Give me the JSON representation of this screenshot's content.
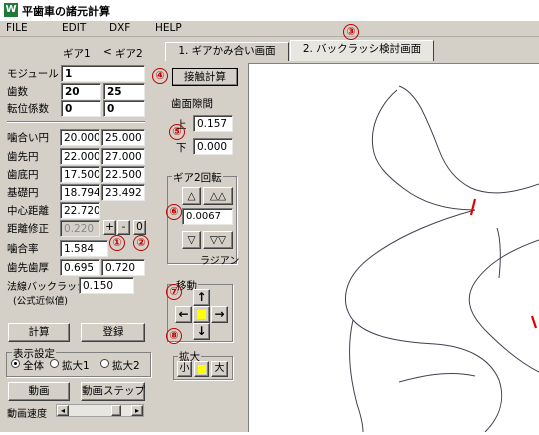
{
  "window": {
    "title": "平歯車の諸元計算"
  },
  "menu": [
    "FILE",
    "EDIT",
    "DXF",
    "HELP"
  ],
  "tabs": [
    "1. ギアかみ合い画面",
    "2. バックラッシ検討画面"
  ],
  "gear_header": {
    "gear1": "ギア1",
    "lt": "<",
    "gear2": "ギア2"
  },
  "params": {
    "module": {
      "label": "モジュール",
      "g1": "1"
    },
    "teeth": {
      "label": "歯数",
      "g1": "20",
      "g2": "25"
    },
    "shift": {
      "label": "転位係数",
      "g1": "0",
      "g2": "0"
    }
  },
  "results": {
    "pitch": {
      "label": "噛合い円",
      "g1": "20.000",
      "g2": "25.000"
    },
    "tip": {
      "label": "歯先円",
      "g1": "22.000",
      "g2": "27.000"
    },
    "root": {
      "label": "歯底円",
      "g1": "17.500",
      "g2": "22.500"
    },
    "base": {
      "label": "基礎円",
      "g1": "18.794",
      "g2": "23.492"
    },
    "center": {
      "label": "中心距離",
      "value": "22.720"
    },
    "center_adj": {
      "label": "距離修正",
      "value": "0.220",
      "plus": "+",
      "minus": "-",
      "zero": "0"
    },
    "contact_ratio": {
      "label": "噛合率",
      "value": "1.584"
    },
    "tip_thickness": {
      "label": "歯先歯厚",
      "g1": "0.695",
      "g2": "0.720"
    },
    "backlash": {
      "label": "法線バックラッシ",
      "value": "0.150",
      "note": "(公式近似値)"
    }
  },
  "buttons": {
    "calc": "計算",
    "register": "登録",
    "anim": "動画",
    "anim_step": "動画ステップ"
  },
  "display": {
    "label": "表示設定",
    "options": [
      "全体",
      "拡大1",
      "拡大2"
    ],
    "selected": "全体"
  },
  "speed": {
    "label": "動画速度"
  },
  "contact_calc": {
    "label": "接触計算"
  },
  "clearance": {
    "label": "歯面隙間",
    "upper_label": "上",
    "upper": "0.157",
    "lower_label": "下",
    "lower": "0.000"
  },
  "rotate": {
    "label": "ギア2回転",
    "up1": "△",
    "up2": "△△",
    "value": "0.0067",
    "down1": "▽",
    "down2": "▽▽",
    "unit": "ラジアン"
  },
  "move": {
    "label": "移動",
    "up": "↑",
    "left": "←",
    "right": "→",
    "down": "↓"
  },
  "zoom": {
    "label": "拡大",
    "small": "小",
    "large": "大"
  },
  "annotations": [
    "①",
    "②",
    "③",
    "④",
    "⑤",
    "⑥",
    "⑦",
    "⑧"
  ],
  "colors": {
    "panel": "#d4d0c8",
    "annotation": "#c00000",
    "contact_mark": "#e00000"
  }
}
